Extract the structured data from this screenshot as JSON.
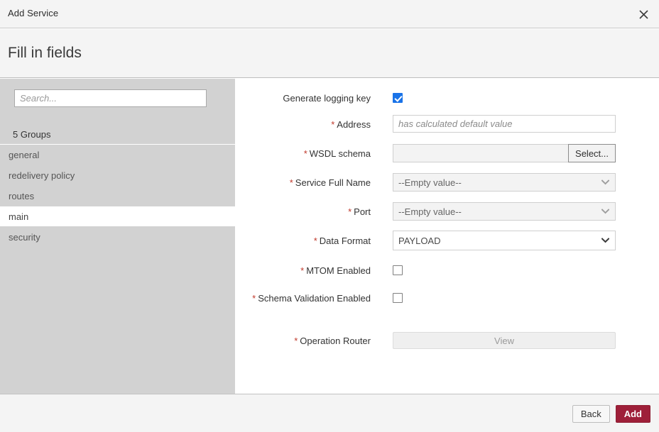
{
  "window": {
    "title": "Add Service",
    "close_icon": "close-icon"
  },
  "heading": {
    "text": "Fill in fields"
  },
  "sidebar": {
    "search": {
      "value": "",
      "placeholder": "Search..."
    },
    "groups_count_label": "5 Groups",
    "items": [
      {
        "label": "general",
        "selected": false
      },
      {
        "label": "redelivery policy",
        "selected": false
      },
      {
        "label": "routes",
        "selected": false
      },
      {
        "label": "main",
        "selected": true
      },
      {
        "label": "security",
        "selected": false
      }
    ]
  },
  "form": {
    "fields": [
      {
        "label": "Generate logging key",
        "required": false,
        "type": "checkbox",
        "checked": true
      },
      {
        "label": "Address",
        "required": true,
        "type": "text",
        "value": "",
        "placeholder": "has calculated default value"
      },
      {
        "label": "WSDL schema",
        "required": true,
        "type": "input-group",
        "value": "",
        "button_label": "Select..."
      },
      {
        "label": "Service Full Name",
        "required": true,
        "type": "select",
        "value": "--Empty value--",
        "enabled": false
      },
      {
        "label": "Port",
        "required": true,
        "type": "select",
        "value": "--Empty value--",
        "enabled": false
      },
      {
        "label": "Data Format",
        "required": true,
        "type": "select",
        "value": "PAYLOAD",
        "enabled": true
      },
      {
        "label": "MTOM Enabled",
        "required": true,
        "type": "checkbox",
        "checked": false
      },
      {
        "label": "Schema Validation Enabled",
        "required": true,
        "type": "checkbox",
        "checked": false
      },
      {
        "label": "Operation Router",
        "required": true,
        "type": "button",
        "button_label": "View"
      }
    ]
  },
  "footer": {
    "back_label": "Back",
    "add_label": "Add"
  },
  "colors": {
    "accent_add": "#9e1f39",
    "required_star": "#c0392b",
    "checkbox_checked": "#1a73e8",
    "sidebar_bg": "#d2d2d2",
    "chrome_bg": "#f4f4f4"
  }
}
